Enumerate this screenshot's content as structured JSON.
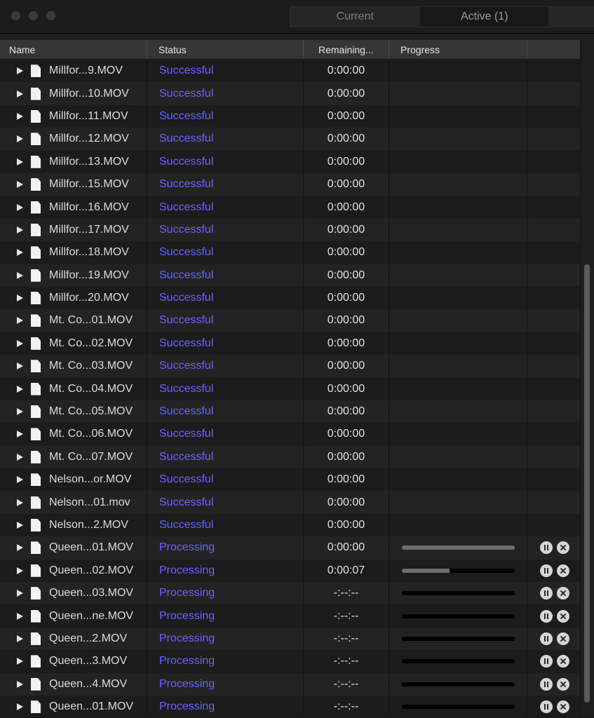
{
  "tabs": [
    {
      "label": "Current",
      "active": false
    },
    {
      "label": "Active (1)",
      "active": true
    }
  ],
  "columns": {
    "name": "Name",
    "status": "Status",
    "remaining": "Remaining...",
    "progress": "Progress"
  },
  "colors": {
    "status_text": "#6a62ff",
    "background": "#1e1e1e"
  },
  "rows": [
    {
      "name": "Millfor...9.MOV",
      "status": "Successful",
      "remaining": "0:00:00",
      "progress": null
    },
    {
      "name": "Millfor...10.MOV",
      "status": "Successful",
      "remaining": "0:00:00",
      "progress": null
    },
    {
      "name": "Millfor...11.MOV",
      "status": "Successful",
      "remaining": "0:00:00",
      "progress": null
    },
    {
      "name": "Millfor...12.MOV",
      "status": "Successful",
      "remaining": "0:00:00",
      "progress": null
    },
    {
      "name": "Millfor...13.MOV",
      "status": "Successful",
      "remaining": "0:00:00",
      "progress": null
    },
    {
      "name": "Millfor...15.MOV",
      "status": "Successful",
      "remaining": "0:00:00",
      "progress": null
    },
    {
      "name": "Millfor...16.MOV",
      "status": "Successful",
      "remaining": "0:00:00",
      "progress": null
    },
    {
      "name": "Millfor...17.MOV",
      "status": "Successful",
      "remaining": "0:00:00",
      "progress": null
    },
    {
      "name": "Millfor...18.MOV",
      "status": "Successful",
      "remaining": "0:00:00",
      "progress": null
    },
    {
      "name": "Millfor...19.MOV",
      "status": "Successful",
      "remaining": "0:00:00",
      "progress": null
    },
    {
      "name": "Millfor...20.MOV",
      "status": "Successful",
      "remaining": "0:00:00",
      "progress": null
    },
    {
      "name": "Mt. Co...01.MOV",
      "status": "Successful",
      "remaining": "0:00:00",
      "progress": null
    },
    {
      "name": "Mt. Co...02.MOV",
      "status": "Successful",
      "remaining": "0:00:00",
      "progress": null
    },
    {
      "name": "Mt. Co...03.MOV",
      "status": "Successful",
      "remaining": "0:00:00",
      "progress": null
    },
    {
      "name": "Mt. Co...04.MOV",
      "status": "Successful",
      "remaining": "0:00:00",
      "progress": null
    },
    {
      "name": "Mt. Co...05.MOV",
      "status": "Successful",
      "remaining": "0:00:00",
      "progress": null
    },
    {
      "name": "Mt. Co...06.MOV",
      "status": "Successful",
      "remaining": "0:00:00",
      "progress": null
    },
    {
      "name": "Mt. Co...07.MOV",
      "status": "Successful",
      "remaining": "0:00:00",
      "progress": null
    },
    {
      "name": "Nelson...or.MOV",
      "status": "Successful",
      "remaining": "0:00:00",
      "progress": null
    },
    {
      "name": "Nelson...01.mov",
      "status": "Successful",
      "remaining": "0:00:00",
      "progress": null
    },
    {
      "name": "Nelson...2.MOV",
      "status": "Successful",
      "remaining": "0:00:00",
      "progress": null
    },
    {
      "name": "Queen...01.MOV",
      "status": "Processing",
      "remaining": "0:00:00",
      "progress": 1.0
    },
    {
      "name": "Queen...02.MOV",
      "status": "Processing",
      "remaining": "0:00:07",
      "progress": 0.42
    },
    {
      "name": "Queen...03.MOV",
      "status": "Processing",
      "remaining": "-:--:--",
      "progress": 0
    },
    {
      "name": "Queen...ne.MOV",
      "status": "Processing",
      "remaining": "-:--:--",
      "progress": 0
    },
    {
      "name": "Queen...2.MOV",
      "status": "Processing",
      "remaining": "-:--:--",
      "progress": 0
    },
    {
      "name": "Queen...3.MOV",
      "status": "Processing",
      "remaining": "-:--:--",
      "progress": 0
    },
    {
      "name": "Queen...4.MOV",
      "status": "Processing",
      "remaining": "-:--:--",
      "progress": 0
    },
    {
      "name": "Queen...01.MOV",
      "status": "Processing",
      "remaining": "-:--:--",
      "progress": 0
    }
  ]
}
